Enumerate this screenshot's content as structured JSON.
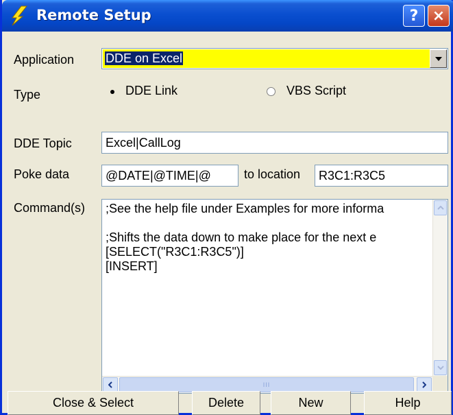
{
  "window": {
    "title": "Remote Setup",
    "help_label": "?",
    "close_label": "×"
  },
  "application": {
    "label": "Application",
    "value": "DDE on Excel"
  },
  "type": {
    "label": "Type",
    "options": [
      "DDE Link",
      "VBS Script"
    ],
    "selected": "DDE Link"
  },
  "dde_topic": {
    "label": "DDE Topic",
    "value": "Excel|CallLog"
  },
  "poke": {
    "label": "Poke data",
    "value": "@DATE|@TIME|@",
    "to_location_label": "to location",
    "location": "R3C1:R3C5"
  },
  "commands": {
    "label": "Command(s)",
    "lines": [
      ";See the help file under Examples for more informa",
      "",
      ";Shifts the data down to make place for the next e",
      "[SELECT(\"R3C1:R3C5\")]",
      "[INSERT]"
    ],
    "hscroll_grip": "III"
  },
  "buttons": {
    "close_select": "Close & Select",
    "delete": "Delete",
    "new": "New",
    "help": "Help"
  },
  "colors": {
    "titlebar": "#0a4fd0",
    "app_highlight": "#ffff00",
    "dialog_bg": "#ece9d8"
  },
  "icons": {
    "title": "lightning-icon",
    "dropdown": "chevron-down-icon"
  }
}
